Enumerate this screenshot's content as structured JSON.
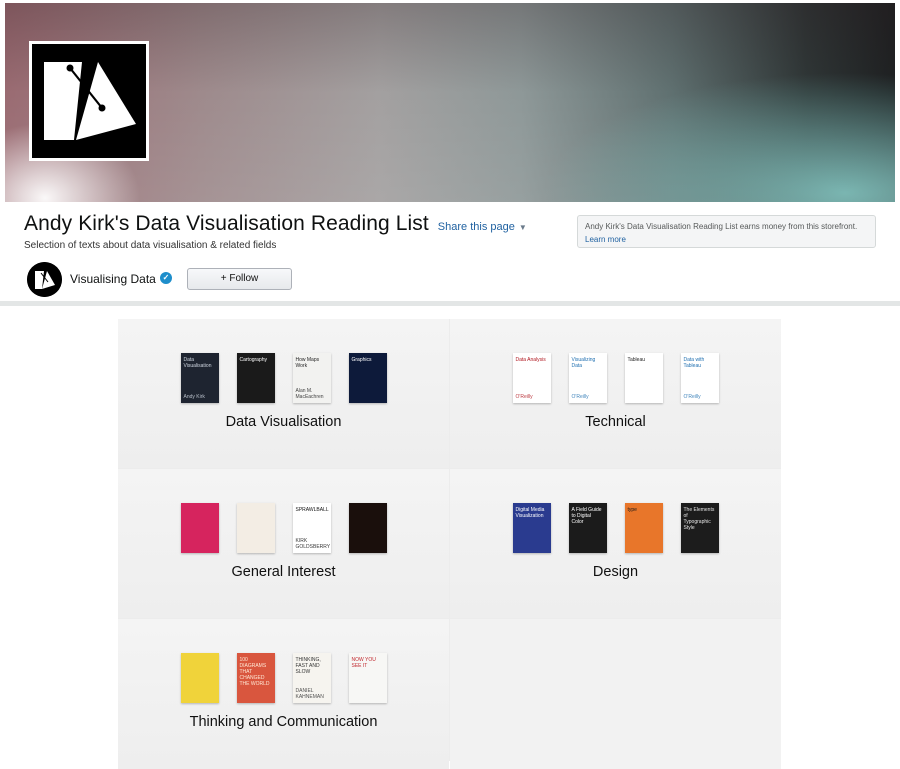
{
  "banner": {
    "logo": "visualising-data-logo"
  },
  "header": {
    "title": "Andy Kirk's Data Visualisation Reading List",
    "share_label": "Share this page",
    "subtitle": "Selection of texts about data visualisation & related fields",
    "earnings_text": "Andy Kirk's Data Visualisation Reading List earns money from this storefront.",
    "earnings_link": "Learn more"
  },
  "channel": {
    "name": "Visualising Data",
    "verified_icon": "verified-check-icon",
    "follow_label": "+ Follow"
  },
  "lists": [
    {
      "label": "Data Visualisation",
      "books": [
        {
          "title": "Data Visualisation",
          "author": "Andy Kirk",
          "color": "#1e2430",
          "text_color": "#cfd6e0"
        },
        {
          "title": "Cartography",
          "author": "",
          "color": "#1a1a1a",
          "text_color": "#ffffff"
        },
        {
          "title": "How Maps Work",
          "author": "Alan M. MacEachren",
          "color": "#f2f2f0",
          "text_color": "#222222"
        },
        {
          "title": "Graphics",
          "author": "",
          "color": "#0d1a3a",
          "text_color": "#ffffff"
        }
      ]
    },
    {
      "label": "Technical",
      "books": [
        {
          "title": "Data Analysis",
          "author": "O'Reilly",
          "color": "#ffffff",
          "text_color": "#b0171f"
        },
        {
          "title": "Visualizing Data",
          "author": "O'Reilly",
          "color": "#ffffff",
          "text_color": "#1f6fb0"
        },
        {
          "title": "Tableau",
          "author": "",
          "color": "#ffffff",
          "text_color": "#222222"
        },
        {
          "title": "Data with Tableau",
          "author": "O'Reilly",
          "color": "#ffffff",
          "text_color": "#1f6fb0"
        }
      ]
    },
    {
      "label": "General Interest",
      "books": [
        {
          "title": "",
          "author": "",
          "color": "#d6245e",
          "text_color": "#ffffff"
        },
        {
          "title": "",
          "author": "",
          "color": "#f3ede4",
          "text_color": "#b0301e"
        },
        {
          "title": "SPRAWLBALL",
          "author": "KIRK GOLDSBERRY",
          "color": "#ffffff",
          "text_color": "#111111"
        },
        {
          "title": "",
          "author": "",
          "color": "#1a0f0c",
          "text_color": "#ffb347"
        }
      ]
    },
    {
      "label": "Design",
      "books": [
        {
          "title": "Digital Media Visualization",
          "author": "",
          "color": "#2a3b8f",
          "text_color": "#ffffff"
        },
        {
          "title": "A Field Guide to Digital Color",
          "author": "",
          "color": "#1b1b1b",
          "text_color": "#ffffff"
        },
        {
          "title": "type",
          "author": "",
          "color": "#e8762a",
          "text_color": "#1a1a1a"
        },
        {
          "title": "The Elements of Typographic Style",
          "author": "",
          "color": "#1c1c1c",
          "text_color": "#e6e6e6"
        }
      ]
    },
    {
      "label": "Thinking and Communication",
      "books": [
        {
          "title": "",
          "author": "",
          "color": "#f0d33a",
          "text_color": "#1a3a8a"
        },
        {
          "title": "100 DIAGRAMS THAT CHANGED THE WORLD",
          "author": "",
          "color": "#d9563e",
          "text_color": "#ffe9d6"
        },
        {
          "title": "THINKING, FAST AND SLOW",
          "author": "DANIEL KAHNEMAN",
          "color": "#f6f4ef",
          "text_color": "#333333"
        },
        {
          "title": "NOW YOU SEE IT",
          "author": "",
          "color": "#f7f7f5",
          "text_color": "#c0272d"
        }
      ]
    }
  ]
}
